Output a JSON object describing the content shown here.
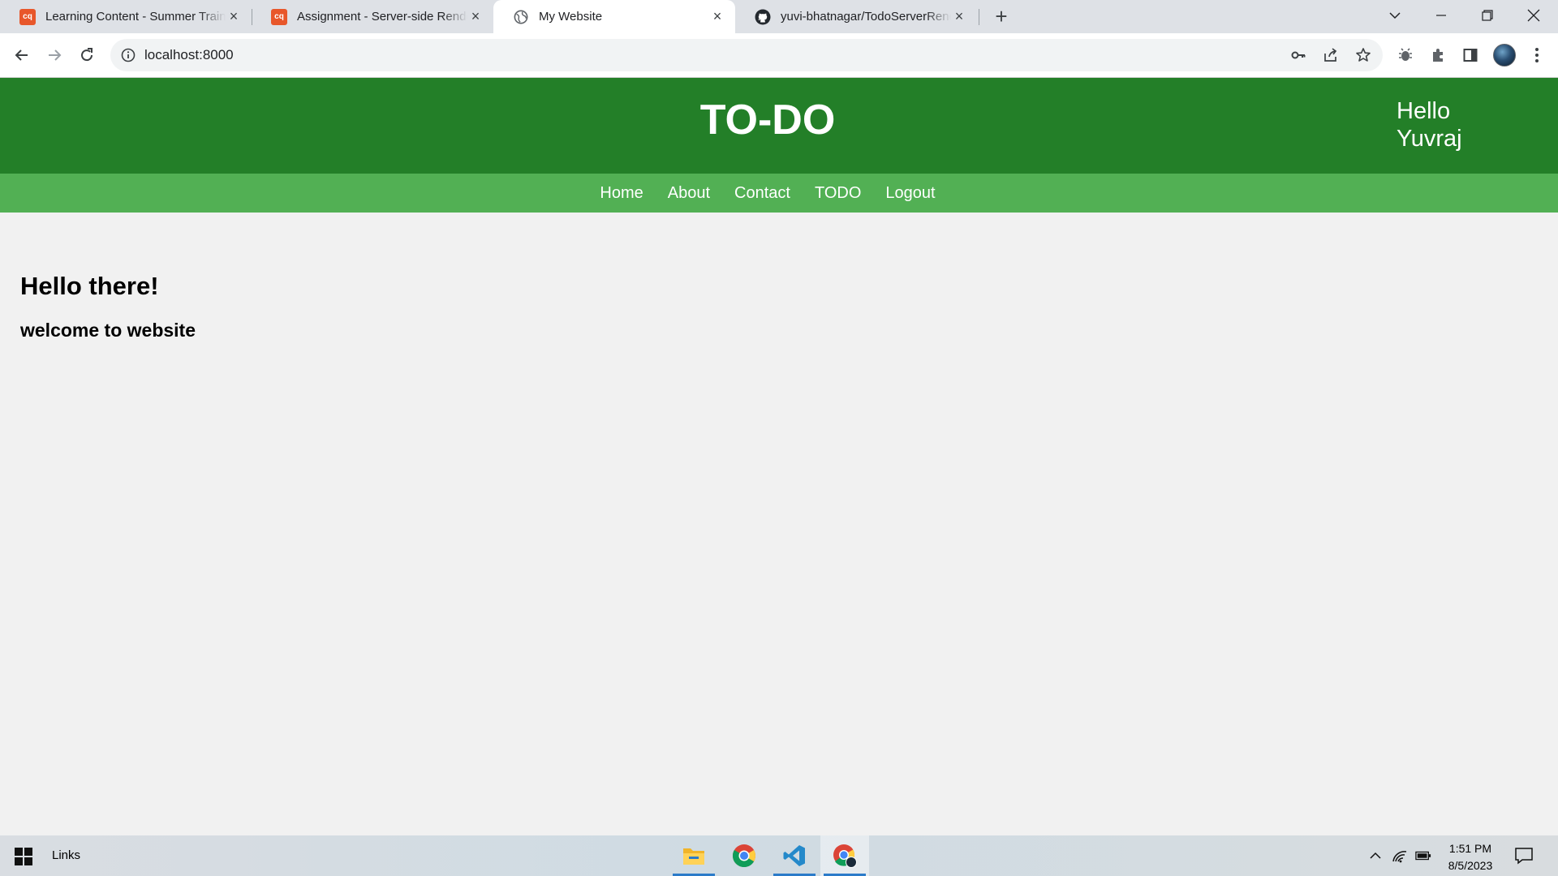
{
  "browser": {
    "tabs": [
      {
        "title": "Learning Content - Summer Training",
        "favicon": "cq",
        "active": false
      },
      {
        "title": "Assignment - Server-side Rendering",
        "favicon": "cq",
        "active": false
      },
      {
        "title": "My Website",
        "favicon": "globe-icon",
        "active": true
      },
      {
        "title": "yuvi-bhatnagar/TodoServerRendering",
        "favicon": "github-icon",
        "active": false
      }
    ],
    "url": "localhost:8000"
  },
  "site": {
    "title": "TO-DO",
    "greeting": "Hello Yuvraj",
    "nav": [
      "Home",
      "About",
      "Contact",
      "TODO",
      "Logout"
    ],
    "heading": "Hello there!",
    "subheading": "welcome to website"
  },
  "taskbar": {
    "links_label": "Links",
    "time": "1:51 PM",
    "date": "8/5/2023"
  },
  "colors": {
    "header": "#237f28",
    "nav": "#52b054",
    "page_bg": "#f1f1f1"
  }
}
